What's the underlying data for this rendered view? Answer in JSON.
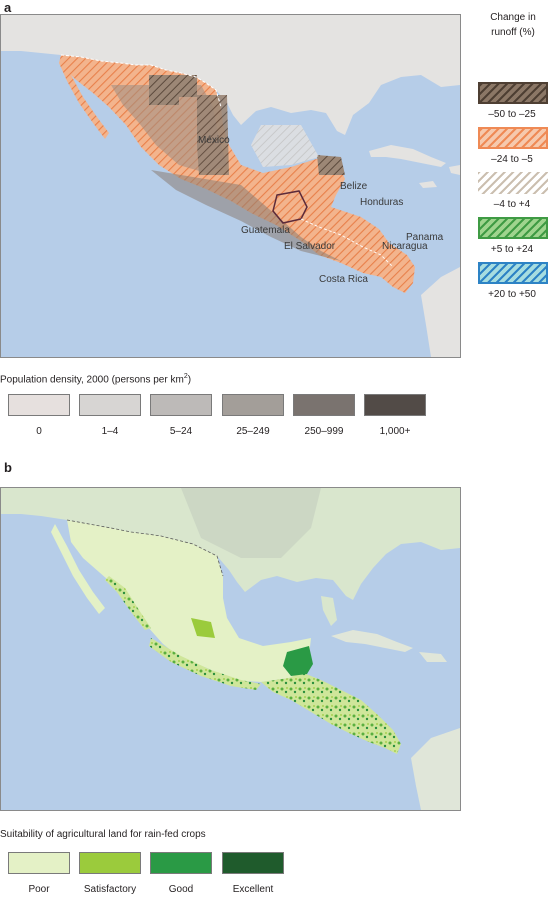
{
  "panel_a": {
    "letter": "a",
    "places": {
      "mexico": "México",
      "belize": "Belize",
      "honduras": "Honduras",
      "guatemala": "Guatemala",
      "el_salvador": "El Salvador",
      "nicaragua": "Nicaragua",
      "panama": "Panama",
      "costa_rica": "Costa Rica"
    },
    "pop_legend": {
      "title": "Population density, 2000 (persons per km",
      "title_sup": "2",
      "title_end": ")",
      "classes": [
        {
          "label": "0",
          "color": "#e6e0de"
        },
        {
          "label": "1–4",
          "color": "#d7d5d3"
        },
        {
          "label": "5–24",
          "color": "#bdbab8"
        },
        {
          "label": "25–249",
          "color": "#a39e99"
        },
        {
          "label": "250–999",
          "color": "#7a736f"
        },
        {
          "label": "1,000+",
          "color": "#524b47"
        }
      ]
    },
    "runoff_legend": {
      "title_line1": "Change in",
      "title_line2": "runoff (%)",
      "classes": [
        {
          "label": "–50 to –25",
          "color": "#8b7766",
          "stripe": "#4e3f33",
          "border": "#4e3f33"
        },
        {
          "label": "–24 to –5",
          "color": "#f6c9ad",
          "stripe": "#ef8a55",
          "border": "#ef8a55"
        },
        {
          "label": "–4 to +4",
          "color": "#ffffff",
          "stripe": "#cbbfb0",
          "border": "none"
        },
        {
          "label": "+5 to +24",
          "color": "#9fd48e",
          "stripe": "#3f9b44",
          "border": "#3f9b44"
        },
        {
          "label": "+20 to +50",
          "color": "#a6dde0",
          "stripe": "#2d83c5",
          "border": "#2d83c5"
        }
      ]
    }
  },
  "panel_b": {
    "letter": "b",
    "suit_legend": {
      "title": "Suitability of agricultural land for rain-fed crops",
      "classes": [
        {
          "label": "Poor",
          "color": "#e4f1c6"
        },
        {
          "label": "Satisfactory",
          "color": "#9bcb3c"
        },
        {
          "label": "Good",
          "color": "#2a9a45"
        },
        {
          "label": "Excellent",
          "color": "#1f5b2c"
        }
      ]
    }
  }
}
